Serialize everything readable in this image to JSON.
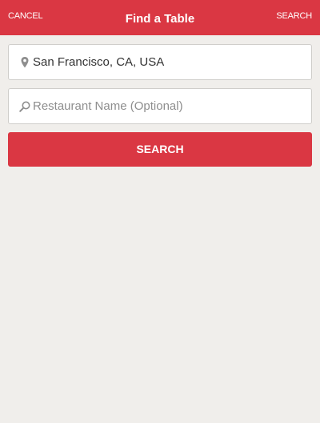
{
  "header": {
    "cancel_label": "CANCEL",
    "title": "Find a Table",
    "search_label": "SEARCH"
  },
  "location": {
    "value": "San Francisco, CA, USA",
    "icon": "map-pin-icon"
  },
  "restaurant": {
    "value": "",
    "placeholder": "Restaurant Name (Optional)",
    "icon": "search-icon"
  },
  "search_button": {
    "label": "SEARCH"
  },
  "colors": {
    "brand": "#da3743",
    "background": "#f0eeeb",
    "icon": "#8e8e8e"
  }
}
